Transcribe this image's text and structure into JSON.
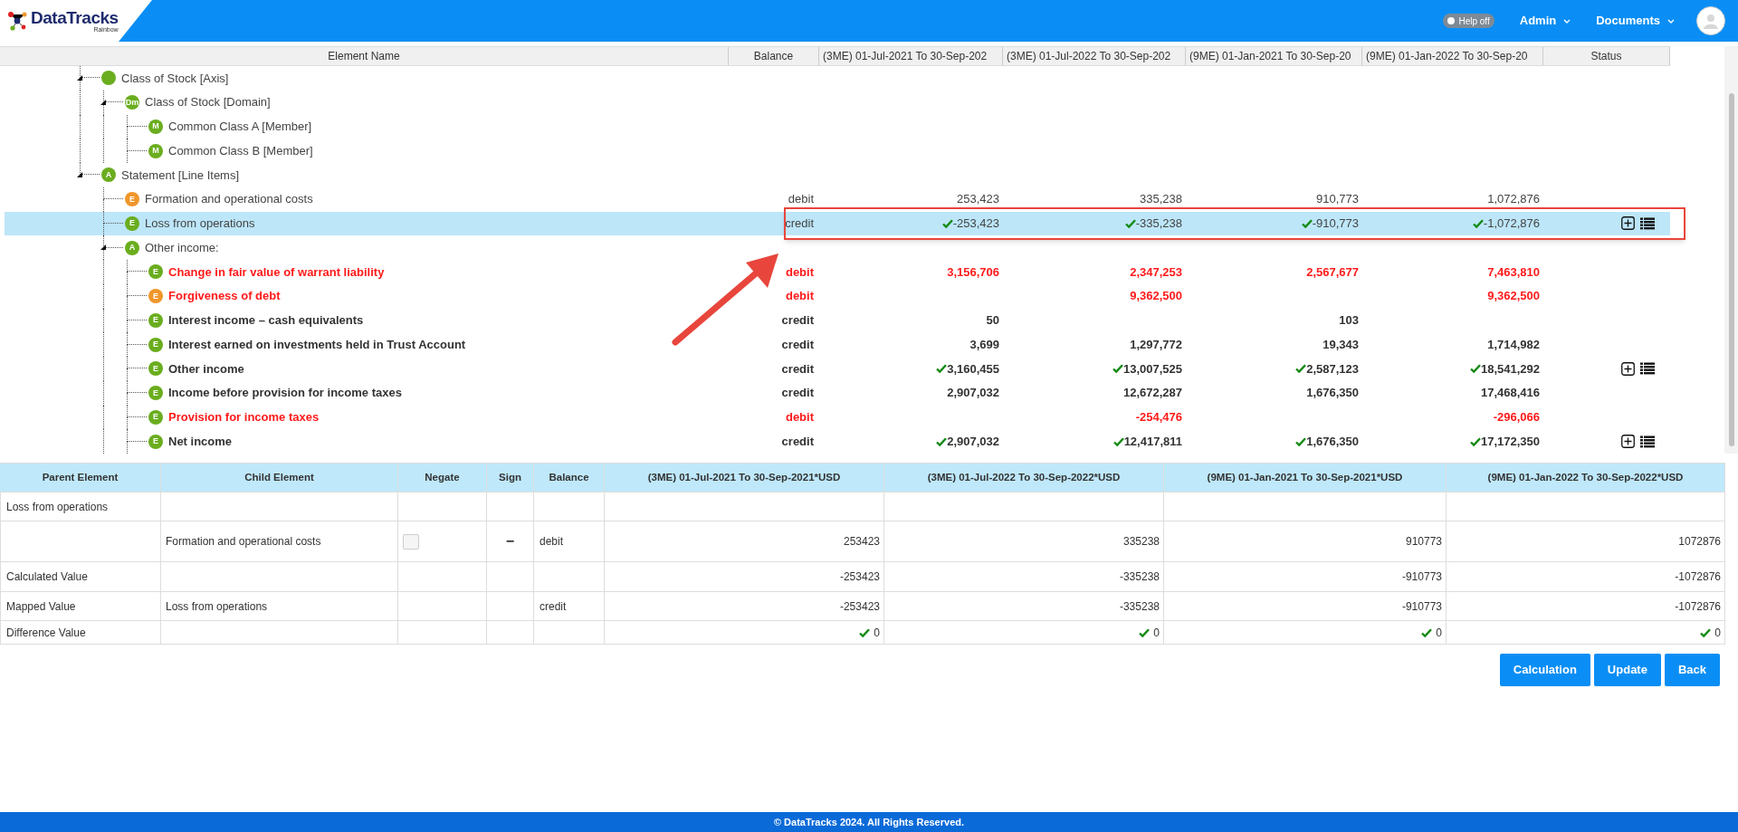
{
  "header": {
    "logo": {
      "name": "DataTracks",
      "tagline": "Rainbow"
    },
    "help_toggle": {
      "label": "Help off",
      "on": false
    },
    "menus": [
      {
        "label": "Admin"
      },
      {
        "label": "Documents"
      }
    ]
  },
  "tree_table": {
    "columns": [
      "Element Name",
      "Balance",
      "(3ME) 01-Jul-2021 To 30-Sep-202",
      "(3ME) 01-Jul-2022 To 30-Sep-202",
      "(9ME) 01-Jan-2021 To 30-Sep-20",
      "(9ME) 01-Jan-2022 To 30-Sep-20",
      "Status"
    ],
    "rows": [
      {
        "label": "Class of Stock [Axis]",
        "color": "#6aad1e",
        "kind": "normal",
        "selected": false,
        "expanded": true,
        "children": [
          {
            "label": "Class of Stock [Domain]",
            "badge": "Dm",
            "color": "#6aad1e",
            "kind": "normal",
            "selected": false,
            "expanded": true,
            "children": [
              {
                "label": "Common Class A [Member]",
                "badge": "M",
                "color": "#6aad1e",
                "kind": "normal",
                "selected": false
              },
              {
                "label": "Common Class B [Member]",
                "badge": "M",
                "color": "#6aad1e",
                "kind": "normal",
                "selected": false
              }
            ]
          }
        ]
      },
      {
        "label": "Statement [Line Items]",
        "badge": "A",
        "color": "#6aad1e",
        "kind": "normal",
        "selected": false,
        "expanded": true,
        "children": [
          {
            "label": "Formation and operational costs",
            "badge": "E",
            "color": "#f0962a",
            "kind": "normal",
            "selected": false,
            "balance": "debit",
            "values": [
              {
                "text": "253,423",
                "checked": false
              },
              {
                "text": "335,238",
                "checked": false
              },
              {
                "text": "910,773",
                "checked": false
              },
              {
                "text": "1,072,876",
                "checked": false
              }
            ],
            "actions": false
          },
          {
            "label": "Loss from operations",
            "badge": "E",
            "color": "#6aad1e",
            "kind": "normal",
            "selected": true,
            "balance": "credit",
            "values": [
              {
                "text": "-253,423",
                "checked": true
              },
              {
                "text": "-335,238",
                "checked": true
              },
              {
                "text": "-910,773",
                "checked": true
              },
              {
                "text": "-1,072,876",
                "checked": true
              }
            ],
            "actions": true
          },
          {
            "label": "Other income:",
            "badge": "A",
            "color": "#6aad1e",
            "kind": "normal",
            "selected": false,
            "expanded": true,
            "children": [
              {
                "label": "Change in fair value of warrant liability",
                "badge": "E",
                "color": "#6aad1e",
                "kind": "alert",
                "selected": false,
                "balance": "debit",
                "values": [
                  {
                    "text": "3,156,706",
                    "checked": false
                  },
                  {
                    "text": "2,347,253",
                    "checked": false
                  },
                  {
                    "text": "2,567,677",
                    "checked": false
                  },
                  {
                    "text": "7,463,810",
                    "checked": false
                  }
                ],
                "actions": false
              },
              {
                "label": "Forgiveness of debt",
                "badge": "E",
                "color": "#f0962a",
                "kind": "alert",
                "selected": false,
                "balance": "debit",
                "values": {
                  "column_4": {
                    "text": "9,362,500",
                    "checked": false
                  },
                  "column_6": {
                    "text": "9,362,500",
                    "checked": false
                  }
                },
                "actions": false
              },
              {
                "label": "Interest income – cash equivalents",
                "badge": "E",
                "color": "#6aad1e",
                "kind": "bold",
                "selected": false,
                "balance": "credit",
                "values": {
                  "column_3": {
                    "text": "50",
                    "checked": false
                  },
                  "column_5": {
                    "text": "103",
                    "checked": false
                  }
                },
                "actions": false
              },
              {
                "label": "Interest earned on investments held in Trust Account",
                "badge": "E",
                "color": "#6aad1e",
                "kind": "bold",
                "selected": false,
                "balance": "credit",
                "values": [
                  {
                    "text": "3,699",
                    "checked": false
                  },
                  {
                    "text": "1,297,772",
                    "checked": false
                  },
                  {
                    "text": "19,343",
                    "checked": false
                  },
                  {
                    "text": "1,714,982",
                    "checked": false
                  }
                ],
                "actions": false
              },
              {
                "label": "Other income",
                "badge": "E",
                "color": "#6aad1e",
                "kind": "bold",
                "selected": false,
                "balance": "credit",
                "values": [
                  {
                    "text": "3,160,455",
                    "checked": true
                  },
                  {
                    "text": "13,007,525",
                    "checked": true
                  },
                  {
                    "text": "2,587,123",
                    "checked": true
                  },
                  {
                    "text": "18,541,292",
                    "checked": true
                  }
                ],
                "actions": true
              },
              {
                "label": "Income before provision for income taxes",
                "badge": "E",
                "color": "#6aad1e",
                "kind": "bold",
                "selected": false,
                "balance": "credit",
                "values": [
                  {
                    "text": "2,907,032",
                    "checked": false
                  },
                  {
                    "text": "12,672,287",
                    "checked": false
                  },
                  {
                    "text": "1,676,350",
                    "checked": false
                  },
                  {
                    "text": "17,468,416",
                    "checked": false
                  }
                ],
                "actions": false
              },
              {
                "label": "Provision for income taxes",
                "badge": "E",
                "color": "#6aad1e",
                "kind": "alert",
                "selected": false,
                "balance": "debit",
                "values": {
                  "column_4": {
                    "text": "-254,476",
                    "checked": false
                  },
                  "column_6": {
                    "text": "-296,066",
                    "checked": false
                  }
                },
                "actions": false
              },
              {
                "label": "Net income",
                "badge": "E",
                "color": "#6aad1e",
                "kind": "bold",
                "selected": false,
                "balance": "credit",
                "values": [
                  {
                    "text": "2,907,032",
                    "checked": true
                  },
                  {
                    "text": "12,417,811",
                    "checked": true
                  },
                  {
                    "text": "1,676,350",
                    "checked": true
                  },
                  {
                    "text": "17,172,350",
                    "checked": true
                  }
                ],
                "actions": true
              }
            ]
          }
        ]
      }
    ]
  },
  "calc_table": {
    "columns": [
      "Parent Element",
      "Child Element",
      "Negate",
      "Sign",
      "Balance",
      "(3ME) 01-Jul-2021 To 30-Sep-2021*USD",
      "(3ME) 01-Jul-2022 To 30-Sep-2022*USD",
      "(9ME) 01-Jan-2021 To 30-Sep-2021*USD",
      "(9ME) 01-Jan-2022 To 30-Sep-2022*USD"
    ],
    "rows": [
      {
        "parent": "Loss from operations"
      },
      {
        "child": "Formation and operational costs",
        "negate": {
          "checked": false
        },
        "sign": "−",
        "balance": "debit",
        "values": [
          {
            "text": "253423",
            "checked": false
          },
          {
            "text": "335238",
            "checked": false
          },
          {
            "text": "910773",
            "checked": false
          },
          {
            "text": "1072876",
            "checked": false
          }
        ]
      },
      {
        "parent": "Calculated Value",
        "values": [
          {
            "text": "-253423",
            "checked": false
          },
          {
            "text": "-335238",
            "checked": false
          },
          {
            "text": "-910773",
            "checked": false
          },
          {
            "text": "-1072876",
            "checked": false
          }
        ]
      },
      {
        "parent": "Mapped Value",
        "child": "Loss from operations",
        "balance": "credit",
        "values": [
          {
            "text": "-253423",
            "checked": false
          },
          {
            "text": "-335238",
            "checked": false
          },
          {
            "text": "-910773",
            "checked": false
          },
          {
            "text": "-1072876",
            "checked": false
          }
        ]
      },
      {
        "parent": "Difference Value",
        "values": [
          {
            "text": "0",
            "checked": true
          },
          {
            "text": "0",
            "checked": true
          },
          {
            "text": "0",
            "checked": true
          },
          {
            "text": "0",
            "checked": true
          }
        ]
      }
    ]
  },
  "buttons": [
    "Calculation",
    "Update",
    "Back"
  ],
  "footer": "© DataTracks 2024. All Rights Reserved."
}
